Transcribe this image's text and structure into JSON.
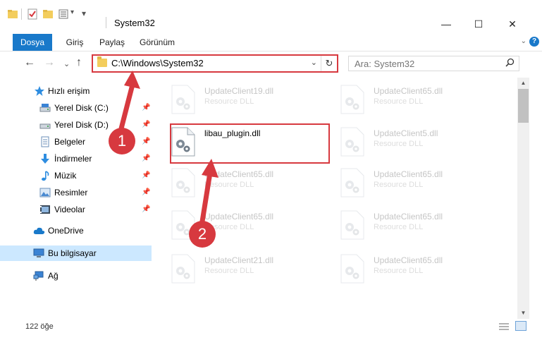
{
  "window": {
    "title": "System32",
    "minimize_glyph": "—",
    "maximize_glyph": "☐",
    "close_glyph": "✕"
  },
  "quick_access_toolbar": {
    "icons": [
      "folder-icon",
      "properties-checkbox-icon",
      "new-folder-icon",
      "customize-icon"
    ],
    "dropdown_glyph": "▾"
  },
  "ribbon": {
    "tabs": [
      {
        "label": "Dosya",
        "active": true
      },
      {
        "label": "Giriş"
      },
      {
        "label": "Paylaş"
      },
      {
        "label": "Görünüm"
      }
    ],
    "expand_glyph": "⌄",
    "help_glyph": "?"
  },
  "nav": {
    "back_glyph": "←",
    "forward_glyph": "→",
    "recent_glyph": "⌄",
    "up_glyph": "↑",
    "address": "C:\\Windows\\System32",
    "address_dropdown_glyph": "⌄",
    "refresh_glyph": "↻",
    "search_placeholder": "Ara: System32",
    "search_glyph": "⚲"
  },
  "sidebar": {
    "items": [
      {
        "label": "Hızlı erişim",
        "icon": "star-icon",
        "pinned": false
      },
      {
        "label": "Yerel Disk (C:)",
        "icon": "drive-icon",
        "pinned": true
      },
      {
        "label": "Yerel Disk (D:)",
        "icon": "drive-icon",
        "pinned": true
      },
      {
        "label": "Belgeler",
        "icon": "document-icon",
        "pinned": true
      },
      {
        "label": "İndirmeler",
        "icon": "download-icon",
        "pinned": true
      },
      {
        "label": "Müzik",
        "icon": "music-icon",
        "pinned": true
      },
      {
        "label": "Resimler",
        "icon": "pictures-icon",
        "pinned": true
      },
      {
        "label": "Videolar",
        "icon": "video-icon",
        "pinned": true
      },
      {
        "label": "OneDrive",
        "icon": "cloud-icon",
        "pinned": false
      },
      {
        "label": "Bu bilgisayar",
        "icon": "computer-icon",
        "pinned": false,
        "selected": true
      },
      {
        "label": "Ağ",
        "icon": "network-icon",
        "pinned": false
      }
    ],
    "pin_glyph": "📌"
  },
  "files": [
    {
      "name": "UpdateClient19.dll",
      "type": "Resource DLL",
      "faded": true
    },
    {
      "name": "UpdateClient65.dll",
      "type": "Resource DLL",
      "faded": true
    },
    {
      "name": "libau_plugin.dll",
      "type": "",
      "faded": false,
      "highlighted": true
    },
    {
      "name": "UpdateClient5.dll",
      "type": "Resource DLL",
      "faded": true
    },
    {
      "name": "UpdateClient65.dll",
      "type": "Resource DLL",
      "faded": true
    },
    {
      "name": "UpdateClient65.dll",
      "type": "Resource DLL",
      "faded": true
    },
    {
      "name": "UpdateClient65.dll",
      "type": "Resource DLL",
      "faded": true
    },
    {
      "name": "UpdateClient65.dll",
      "type": "Resource DLL",
      "faded": true
    },
    {
      "name": "UpdateClient21.dll",
      "type": "Resource DLL",
      "faded": true
    },
    {
      "name": "UpdateClient65.dll",
      "type": "Resource DLL",
      "faded": true
    }
  ],
  "status": {
    "item_count": "122 öğe"
  },
  "annotations": {
    "badge_1": "1",
    "badge_2": "2",
    "color": "#d7393f"
  },
  "colors": {
    "accent": "#1979ca",
    "highlight": "#d7393f",
    "selected_row": "#cce8ff"
  }
}
